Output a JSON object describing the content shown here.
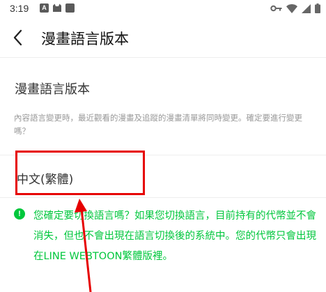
{
  "status_bar": {
    "time": "3:19",
    "left_icons": [
      "text-a-icon",
      "cat-icon",
      "square-icon"
    ],
    "right_icons": [
      "key-icon",
      "wifi-icon",
      "signal-icon",
      "battery-icon"
    ],
    "icon_a_text": "A"
  },
  "nav": {
    "title": "漫畫語言版本",
    "back_icon": "chevron-left-icon"
  },
  "section": {
    "title": "漫畫語言版本",
    "description": "內容語言變更時，最近觀看的漫畫及追蹤的漫畫清單將同時變更。確定要進行變更嗎？"
  },
  "option": {
    "label": "中文(繁體)"
  },
  "notice": {
    "icon": "exclamation-circle-icon",
    "icon_glyph": "!",
    "text": "您確定要切換語言嗎？如果您切換語言，目前持有的代幣並不會消失，但也不會出現在語言切換後的系統中。您的代幣只會出現在LINE WEBTOON繁體版裡。"
  },
  "colors": {
    "accent_green": "#00c73c",
    "annotation_red": "#e60000"
  }
}
